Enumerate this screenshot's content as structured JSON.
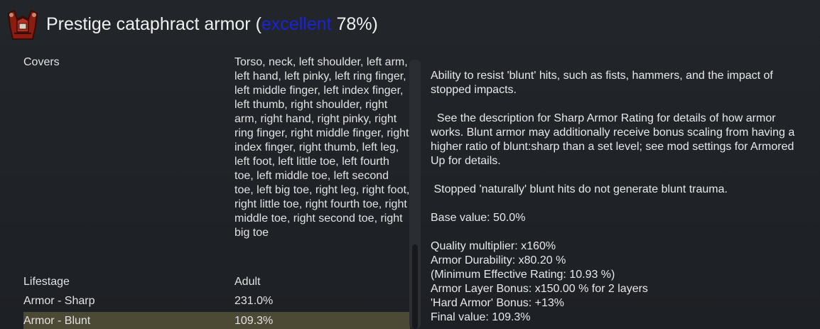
{
  "title": {
    "name": "Prestige cataphract armor",
    "open_paren": " (",
    "quality": "excellent",
    "percent": " 78%)",
    "quality_color": "#1a24d6"
  },
  "icon": "armor-icon",
  "stats": [
    {
      "label": "Covers",
      "value": "Torso, neck, left shoulder, left arm, left hand, left pinky, left ring finger, left middle finger, left index finger, left thumb, right shoulder, right arm, right hand, right pinky, right ring finger, right middle finger, right index finger, right thumb, left leg, left foot, left little toe, left fourth toe, left middle toe, left second toe, left big toe, right leg, right foot, right little toe, right fourth toe, right middle toe, right second toe, right big toe"
    },
    {
      "label": "Lifestage",
      "value": "Adult"
    },
    {
      "label": "Armor - Sharp",
      "value": "231.0%"
    },
    {
      "label": "Armor - Blunt",
      "value": "109.3%"
    }
  ],
  "description": {
    "intro": "Ability to resist 'blunt' hits, such as fists, hammers, and the impact of stopped impacts.",
    "detail": "  See the description for Sharp Armor Rating for details of how armor works. Blunt armor may additionally receive bonus scaling from having a higher ratio of blunt:sharp than a set level; see mod settings for Armored Up for details.",
    "note": " Stopped 'naturally' blunt hits do not generate blunt trauma.",
    "base_value": "Base value: 50.0%",
    "quality_multiplier": "Quality multiplier: x160%",
    "durability": "Armor Durability: x80.20 %",
    "min_rating": "(Minimum Effective Rating: 10.93 %)",
    "layer_bonus": "Armor Layer Bonus: x150.00 % for 2 layers",
    "hard_armor": "'Hard Armor' Bonus: +13%",
    "final_value": "Final value: 109.3%"
  },
  "colors": {
    "selected_row": "#4c4935",
    "background": "#1d2024"
  }
}
